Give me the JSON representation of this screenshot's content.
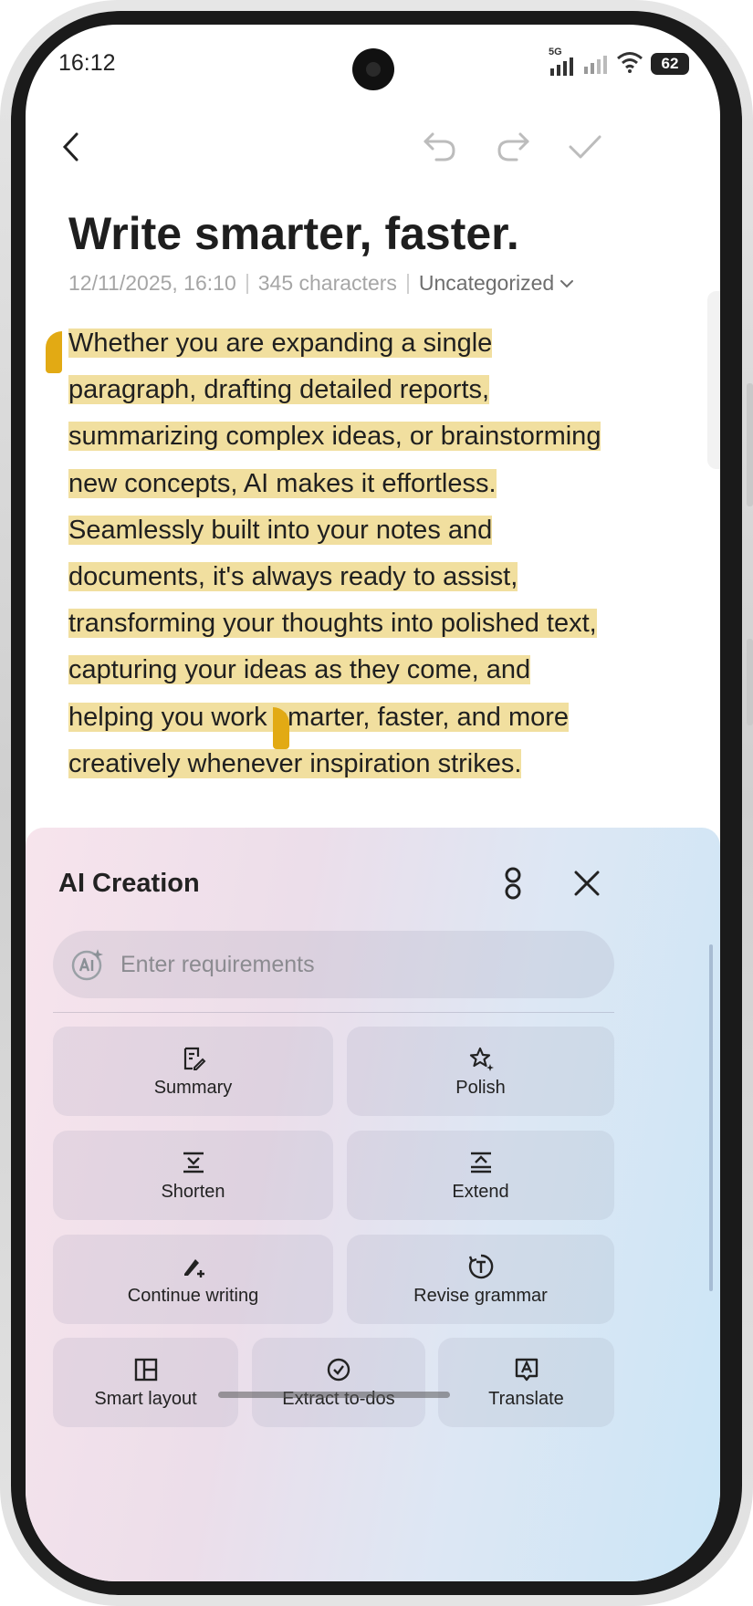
{
  "status_bar": {
    "time": "16:12",
    "network": "5G",
    "battery": "62"
  },
  "toolbar": {
    "back_icon": "chevron-left-icon",
    "undo_icon": "undo-icon",
    "redo_icon": "redo-icon",
    "done_icon": "check-icon"
  },
  "note": {
    "title": "Write smarter, faster.",
    "date": "12/11/2025, 16:10",
    "char_count": "345 characters",
    "category": "Uncategorized",
    "body": "Whether you are expanding a single paragraph, drafting detailed reports, summarizing complex ideas, or brainstorming new concepts, AI makes it effortless. Seamlessly built into your notes and documents, it's always ready to assist, transforming your thoughts into polished text, capturing your ideas as they come, and helping you work smarter, faster, and more creatively whenever inspiration strikes."
  },
  "ai_panel": {
    "title": "AI Creation",
    "input_placeholder": "Enter requirements",
    "actions": [
      {
        "label": "Summary",
        "icon": "summary-icon"
      },
      {
        "label": "Polish",
        "icon": "polish-icon"
      },
      {
        "label": "Shorten",
        "icon": "shorten-icon"
      },
      {
        "label": "Extend",
        "icon": "extend-icon"
      },
      {
        "label": "Continue writing",
        "icon": "continue-writing-icon"
      },
      {
        "label": "Revise grammar",
        "icon": "revise-grammar-icon"
      },
      {
        "label": "Smart layout",
        "icon": "smart-layout-icon"
      },
      {
        "label": "Extract to-dos",
        "icon": "extract-todos-icon"
      },
      {
        "label": "Translate",
        "icon": "translate-icon"
      }
    ]
  },
  "colors": {
    "highlight": "#f1df9f",
    "handle": "#e2aa14",
    "panel_gradient_start": "#f7e4ec",
    "panel_gradient_end": "#cbe6f6"
  }
}
